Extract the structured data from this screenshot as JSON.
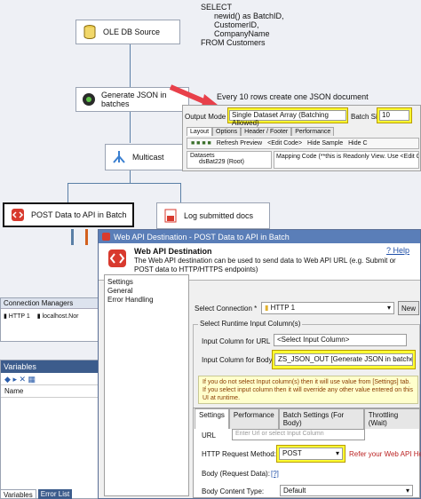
{
  "sql_text": "SELECT\n      newid() as BatchID,\n      CustomerID,\n      CompanyName\nFROM Customers",
  "nodes": {
    "ole_db_source": "OLE DB Source",
    "generate_json": "Generate JSON in batches",
    "multicast": "Multicast",
    "post_data": "POST Data to API in Batch",
    "log_docs": "Log submitted docs"
  },
  "annotation": "Every 10 rows create one JSON document",
  "json_panel": {
    "output_mode_label": "Output Mode",
    "output_mode_value": "Single Dataset Array (Batching Allowed)",
    "batch_size_label": "Batch Size",
    "batch_size_value": "10",
    "tabs": [
      "Layout",
      "Options",
      "Header / Footer",
      "Performance"
    ],
    "toolbar": [
      "Refresh Preview",
      "<Edit Code>",
      "Hide Sample",
      "Hide C"
    ],
    "tree_root": "Datasets",
    "tree_child": "dsBat229 (Root)",
    "mapping_note": "Mapping Code (**this is Readonly View. Use <Edit Code> to change)"
  },
  "connection_managers": {
    "header": "Connection Managers",
    "items": [
      "HTTP 1",
      "localhost.Nor"
    ]
  },
  "variables": {
    "header": "Variables",
    "col_name": "Name"
  },
  "bottom_tabs": [
    "Variables",
    "Error List"
  ],
  "dialog": {
    "title": "Web API Destination - POST Data to API in Batch",
    "heading": "Web API Destination",
    "description": "The Web API destination can be used to send data to Web API URL (e.g. Submit or POST data to HTTP/HTTPS endpoints)",
    "help": "Help",
    "nav": [
      "Settings",
      "General",
      "Error Handling"
    ],
    "select_connection_label": "Select Connection *",
    "connection_value": "HTTP 1",
    "new_button": "New",
    "runtime_group": "Select Runtime Input Column(s)",
    "input_url_label": "Input Column for URL",
    "input_url_value": "<Select Input Column>",
    "input_body_label": "Input Column for Body",
    "input_body_value": "ZS_JSON_OUT [Generate JSON in batches]",
    "info": "If you do not select Input column(s) then it will use value from [Settings] tab. If you select input column then it will override any other value entered on this UI at runtime.",
    "tabs": [
      "Settings",
      "Performance",
      "Batch Settings (For Body)",
      "Throttling (Wait)"
    ],
    "url_label": "URL",
    "url_placeholder": "Enter Url or select Input Column",
    "method_label": "HTTP Request Method:",
    "method_value": "POST",
    "method_hint": "Refer your Web API Help",
    "body_label": "Body (Request Data):",
    "body_help": "[?]",
    "content_type_label": "Body Content Type:",
    "content_type_value": "Default"
  },
  "colors": {
    "highlight": "#ffff33",
    "arrow": "#e8404a",
    "titlebar": "#5a7eb8"
  }
}
